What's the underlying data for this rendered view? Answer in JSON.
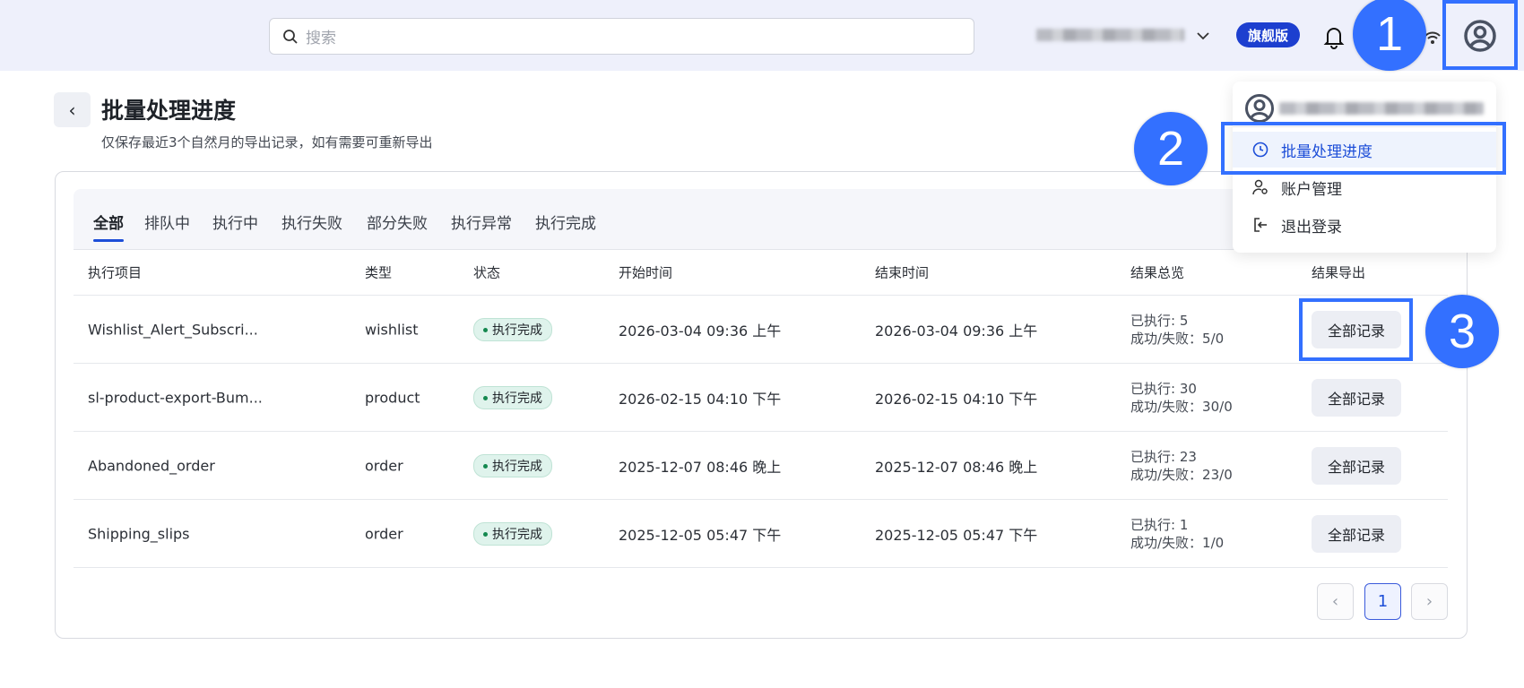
{
  "header": {
    "search_placeholder": "搜索",
    "plan_badge": "旗舰版"
  },
  "annotations": [
    "1",
    "2",
    "3"
  ],
  "page": {
    "title": "批量处理进度",
    "subtitle": "仅保存最近3个自然月的导出记录，如有需要可重新导出"
  },
  "tabs": [
    "全部",
    "排队中",
    "执行中",
    "执行失败",
    "部分失败",
    "执行异常",
    "执行完成"
  ],
  "table": {
    "columns": [
      "执行项目",
      "类型",
      "状态",
      "开始时间",
      "结束时间",
      "结果总览",
      "结果导出"
    ],
    "rows": [
      {
        "name": "Wishlist_Alert_Subscri...",
        "type": "wishlist",
        "status": "执行完成",
        "start": "2026-03-04 09:36 上午",
        "end": "2026-03-04 09:36 上午",
        "executed": "已执行: 5",
        "success_fail": "成功/失败：5/0",
        "action": "全部记录"
      },
      {
        "name": "sl-product-export-Bum...",
        "type": "product",
        "status": "执行完成",
        "start": "2026-02-15 04:10 下午",
        "end": "2026-02-15 04:10 下午",
        "executed": "已执行: 30",
        "success_fail": "成功/失败：30/0",
        "action": "全部记录"
      },
      {
        "name": "Abandoned_order",
        "type": "order",
        "status": "执行完成",
        "start": "2025-12-07 08:46 晚上",
        "end": "2025-12-07 08:46 晚上",
        "executed": "已执行: 23",
        "success_fail": "成功/失败：23/0",
        "action": "全部记录"
      },
      {
        "name": "Shipping_slips",
        "type": "order",
        "status": "执行完成",
        "start": "2025-12-05 05:47 下午",
        "end": "2025-12-05 05:47 下午",
        "executed": "已执行: 1",
        "success_fail": "成功/失败：1/0",
        "action": "全部记录"
      }
    ]
  },
  "pagination": {
    "current": "1",
    "prev": "‹",
    "next": "›"
  },
  "user_menu": {
    "items": [
      "批量处理进度",
      "账户管理",
      "退出登录"
    ]
  }
}
